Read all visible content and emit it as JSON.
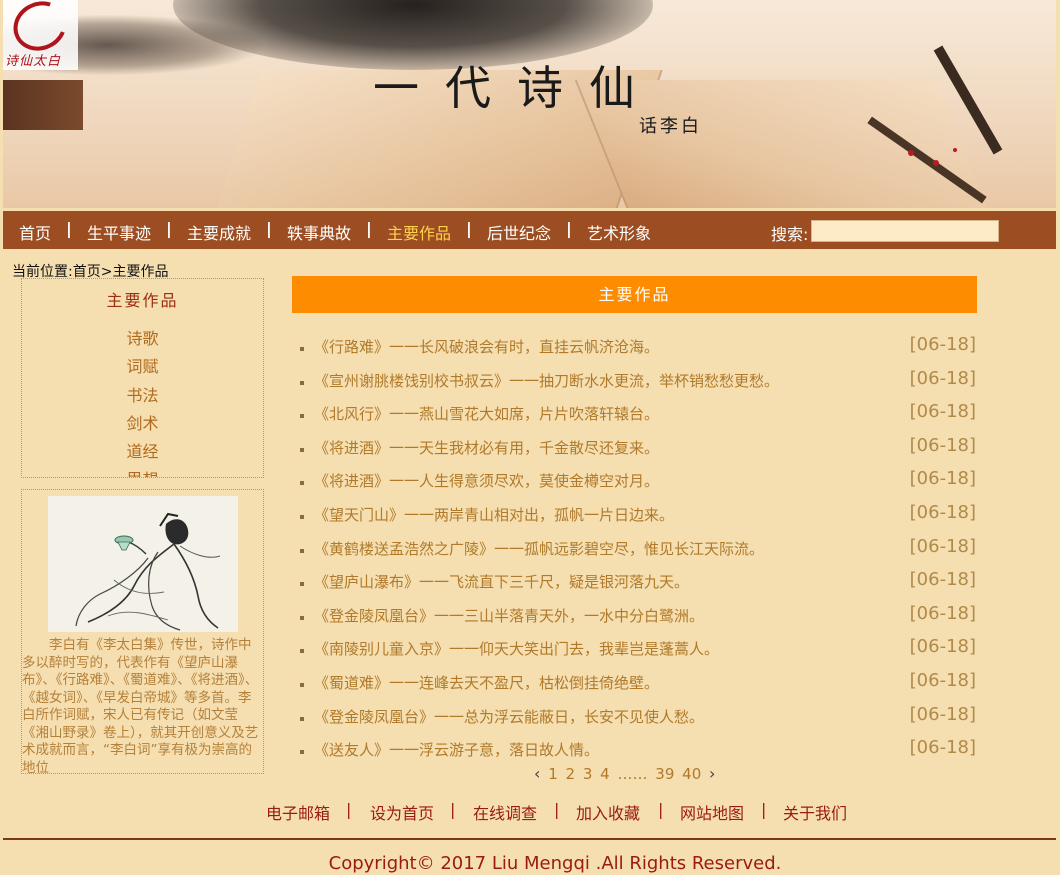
{
  "brand": {
    "logo_text": "诗仙太白",
    "title": "一代诗仙",
    "subtitle": "话李白"
  },
  "nav": {
    "items": [
      {
        "label": "首页",
        "active": false
      },
      {
        "label": "生平事迹",
        "active": false
      },
      {
        "label": "主要成就",
        "active": false
      },
      {
        "label": "轶事典故",
        "active": false
      },
      {
        "label": "主要作品",
        "active": true
      },
      {
        "label": "后世纪念",
        "active": false
      },
      {
        "label": "艺术形象",
        "active": false
      }
    ],
    "separator": "|",
    "search_label": "搜索:",
    "search_value": ""
  },
  "breadcrumb": {
    "prefix": "当前位置:",
    "home": "首页",
    "arrow": ">",
    "current": "主要作品"
  },
  "sidebar": {
    "heading": "主要作品",
    "items": [
      "诗歌",
      "词赋",
      "书法",
      "剑术",
      "道经",
      "思想"
    ],
    "description": "李白有《李太白集》传世，诗作中多以醉时写的，代表作有《望庐山瀑布》、《行路难》、《蜀道难》、《将进酒》、《越女词》、《早发白帝城》等多首。李白所作词赋，宋人已有传记（如文莹《湘山野录》卷上），就其开创意义及艺术成就而言，“李白词”享有极为崇高的地位"
  },
  "main": {
    "header": "主要作品",
    "works": [
      {
        "title": "《行路难》一一长风破浪会有时，直挂云帆济沧海。",
        "date": "[06-18]"
      },
      {
        "title": "《宣州谢朓楼饯别校书叔云》一一抽刀断水水更流，举杯销愁愁更愁。",
        "date": "[06-18]"
      },
      {
        "title": "《北风行》一一燕山雪花大如席，片片吹落轩辕台。",
        "date": "[06-18]"
      },
      {
        "title": "《将进酒》一一天生我材必有用，千金散尽还复来。",
        "date": "[06-18]"
      },
      {
        "title": "《将进酒》一一人生得意须尽欢，莫使金樽空对月。",
        "date": "[06-18]"
      },
      {
        "title": "《望天门山》一一两岸青山相对出，孤帆一片日边来。",
        "date": "[06-18]"
      },
      {
        "title": "《黄鹤楼送孟浩然之广陵》一一孤帆远影碧空尽，惟见长江天际流。",
        "date": "[06-18]"
      },
      {
        "title": "《望庐山瀑布》一一飞流直下三千尺，疑是银河落九天。",
        "date": "[06-18]"
      },
      {
        "title": "《登金陵凤凰台》一一三山半落青天外，一水中分白鹭洲。",
        "date": "[06-18]"
      },
      {
        "title": "《南陵别儿童入京》一一仰天大笑出门去，我辈岂是蓬蒿人。",
        "date": "[06-18]"
      },
      {
        "title": "《蜀道难》一一连峰去天不盈尺，枯松倒挂倚绝壁。",
        "date": "[06-18]"
      },
      {
        "title": "《登金陵凤凰台》一一总为浮云能蔽日，长安不见使人愁。",
        "date": "[06-18]"
      },
      {
        "title": "《送友人》一一浮云游子意，落日故人情。",
        "date": "[06-18]"
      }
    ]
  },
  "pager": {
    "prev": "‹",
    "pages": [
      "1",
      "2",
      "3",
      "4"
    ],
    "ellipsis": "……",
    "last_pages": [
      "39",
      "40"
    ],
    "next": "›"
  },
  "footer": {
    "links": [
      "电子邮箱",
      "设为首页",
      "在线调查",
      "加入收藏",
      "网站地图",
      "关于我们"
    ],
    "separator": "|",
    "copyright": "Copyright© 2017  Liu Mengqi .All Rights Reserved."
  },
  "colors": {
    "page_bg": "#f5deb0",
    "nav_bg": "#9c4e22",
    "nav_active": "#ffd24a",
    "list_header_bg": "#fe8c00",
    "link_text": "#b07a2a",
    "footer_text": "#9b1a12"
  }
}
